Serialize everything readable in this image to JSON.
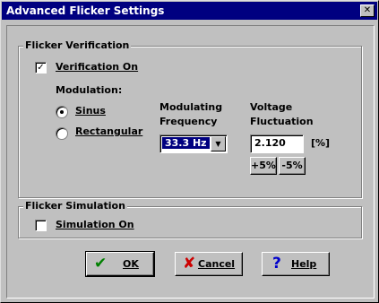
{
  "window": {
    "title": "Advanced Flicker Settings",
    "close_glyph": "✕"
  },
  "verification": {
    "group_label": "Flicker Verification",
    "checkbox_label": "Verification On",
    "checked": true,
    "modulation_label": "Modulation:",
    "radio_sinus": "Sinus",
    "radio_rectangular": "Rectangular",
    "selected": "Sinus",
    "freq_label_line1": "Modulating",
    "freq_label_line2": "Frequency",
    "freq_value": "33.3 Hz",
    "volt_label_line1": "Voltage",
    "volt_label_line2": "Fluctuation",
    "volt_value": "2.120",
    "volt_unit": "[%]",
    "plus_btn": "+5%",
    "minus_btn": "-5%"
  },
  "simulation": {
    "group_label": "Flicker Simulation",
    "checkbox_label": "Simulation On",
    "checked": false
  },
  "buttons": {
    "ok": "OK",
    "cancel": "Cancel",
    "help": "Help"
  },
  "icons": {
    "ok": "checkmark-icon",
    "cancel": "x-icon",
    "help": "question-icon"
  },
  "colors": {
    "title_bar": "#000080",
    "ok_icon": "#008000",
    "cancel_icon": "#cc0000",
    "help_icon": "#0000cc"
  }
}
